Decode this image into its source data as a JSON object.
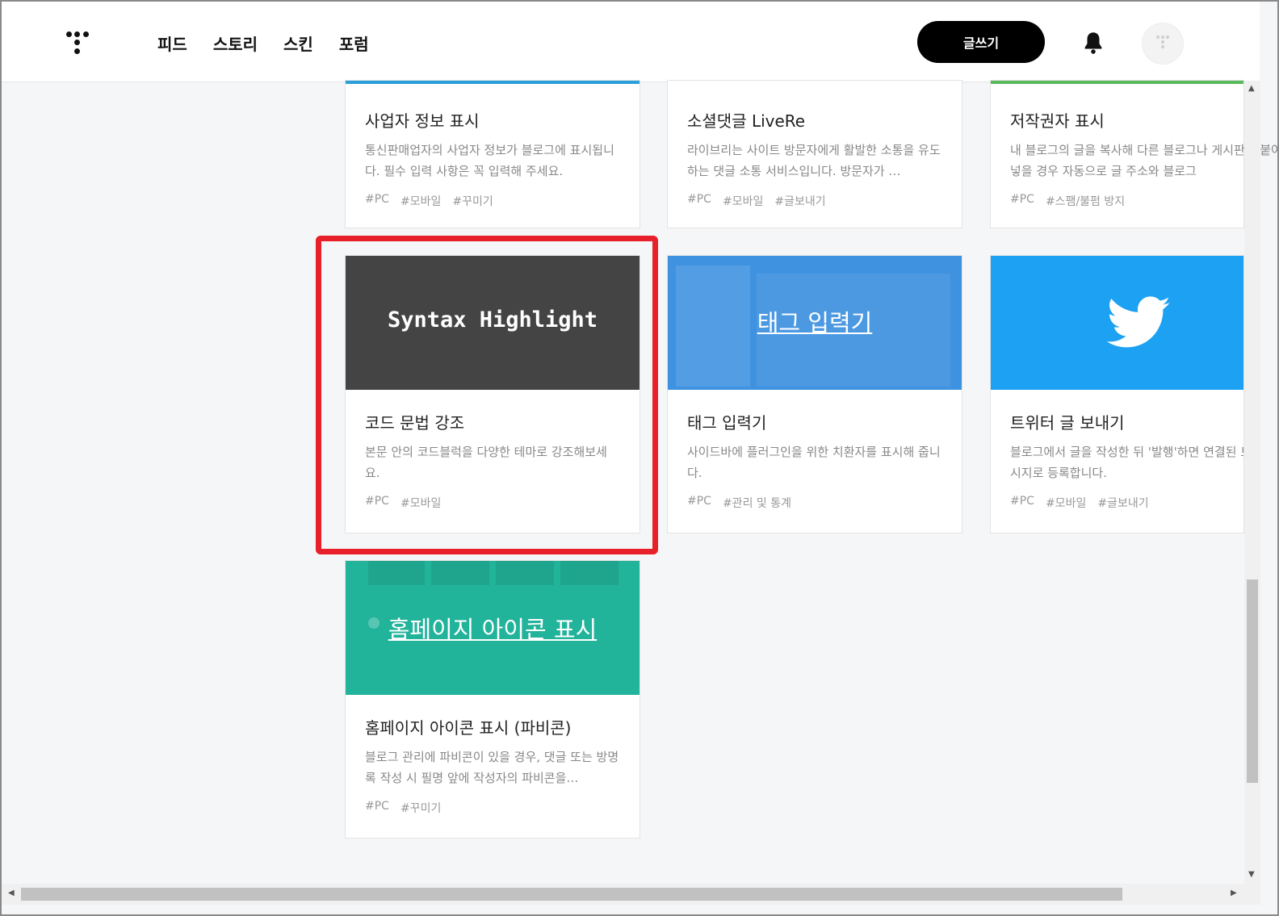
{
  "nav": {
    "items": [
      "피드",
      "스토리",
      "스킨",
      "포럼"
    ],
    "write_label": "글쓰기"
  },
  "cards": [
    {
      "title": "사업자 정보 표시",
      "desc": "통신판매업자의 사업자 정보가 블로그에 표시됩니다. 필수 입력 사항은 꼭 입력해 주세요.",
      "tags": [
        "#PC",
        "#모바일",
        "#꾸미기"
      ],
      "accent": "#2b9fd9"
    },
    {
      "title": "소셜댓글 LiveRe",
      "desc": "라이브리는 사이트 방문자에게 활발한 소통을 유도하는 댓글 소통 서비스입니다. 방문자가 …",
      "tags": [
        "#PC",
        "#모바일",
        "#글보내기"
      ]
    },
    {
      "title": "저작권자 표시",
      "desc": "내 블로그의 글을 복사해 다른 블로그나 게시판에 붙여넣을 경우 자동으로 글 주소와 블로그",
      "tags": [
        "#PC",
        "#스팸/불펌 방지"
      ],
      "accent": "#5cb85c"
    },
    {
      "title": "코드 문법 강조",
      "desc": "본문 안의 코드블럭을 다양한 테마로 강조해보세요.",
      "tags": [
        "#PC",
        "#모바일"
      ],
      "thumb_text": "Syntax Highlight",
      "thumb_color": "#444444"
    },
    {
      "title": "태그 입력기",
      "desc": "사이드바에 플러그인을 위한 치환자를 표시해 줍니다.",
      "tags": [
        "#PC",
        "#관리 및 통계"
      ],
      "thumb_text": "태그 입력기",
      "thumb_color": "#3f92e0"
    },
    {
      "title": "트위터 글 보내기",
      "desc": "블로그에서 글을 작성한 뒤 '발행'하면 연결된 트위터에 메시지로 등록합니다.",
      "tags": [
        "#PC",
        "#모바일",
        "#글보내기"
      ],
      "thumb_color": "#1da1f2",
      "thumb_icon": "twitter-bird-icon"
    },
    {
      "title": "홈페이지 아이콘 표시 (파비콘)",
      "desc": "블로그 관리에 파비콘이 있을 경우, 댓글 또는 방명록 작성 시 필명 앞에 작성자의 파비콘을…",
      "tags": [
        "#PC",
        "#꾸미기"
      ],
      "thumb_text": "홈페이지 아이콘 표시",
      "thumb_color": "#22b39b"
    }
  ],
  "icons": {
    "logo": "tistory-logo-icon",
    "notification": "bell-icon",
    "profile": "avatar-icon"
  },
  "highlight_color": "#e8202a"
}
